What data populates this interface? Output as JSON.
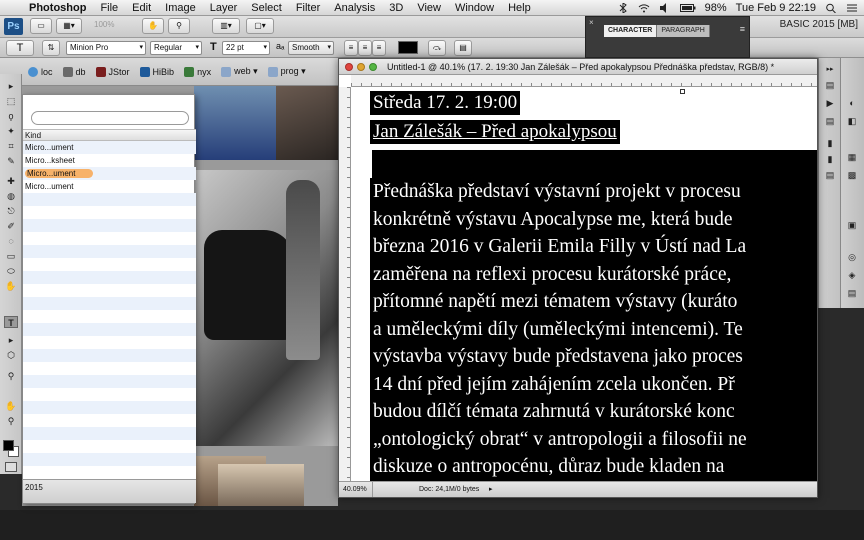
{
  "menubar": {
    "apple": "",
    "items": [
      "Photoshop",
      "File",
      "Edit",
      "Image",
      "Layer",
      "Select",
      "Filter",
      "Analysis",
      "3D",
      "View",
      "Window",
      "Help"
    ],
    "battery": "98%",
    "datetime": "Tue Feb 9  22:19"
  },
  "appbar": {
    "logo": "Ps",
    "zoom": "100%",
    "workspace": "BASIC 2015 [MB]"
  },
  "options": {
    "tool_glyph": "T",
    "orient_glyph": "⇅",
    "font_family": "Minion Pro",
    "font_style": "Regular",
    "font_size": "22 pt",
    "antialias": "Smooth",
    "size_glyph": "T",
    "align_left": "≡",
    "align_center": "≡",
    "align_right": "≡",
    "warp_glyph": "⤼",
    "panels_glyph": "▤",
    "cancel_glyph": "⊘",
    "commit_glyph": "✓"
  },
  "char_panel": {
    "tabs": [
      "CHARACTER",
      "PARAGRAPH"
    ],
    "close_glyph": "×",
    "menu_glyph": "≡"
  },
  "bookmarks": [
    {
      "label": "loc",
      "icon": "#4a90d0"
    },
    {
      "label": "db",
      "icon": "#6a6a6a"
    },
    {
      "label": "JStor",
      "icon": "#7a1e1e"
    },
    {
      "label": "HiBib",
      "icon": "#1e5a9a"
    },
    {
      "label": "nyx",
      "icon": "#3a7a3a"
    },
    {
      "label": "web ▾",
      "icon": "#8ba6c9"
    },
    {
      "label": "prog ▾",
      "icon": "#8ba6c9"
    }
  ],
  "finder": {
    "column_kind": "Kind",
    "rows": [
      "Micro...ument",
      "Micro...ksheet",
      "Micro...ument",
      "Micro...ument"
    ],
    "selected_index": 2,
    "footer": "2015"
  },
  "document": {
    "title": "Untitled-1 @ 40.1% (17. 2. 19:30 Jan Zálešák – Před apokalypsou  Přednáška představ, RGB/8) *",
    "zoom": "40.09%",
    "doc_size": "Doc: 24,1M/0 bytes",
    "heading_lines": [
      "Středa 17. 2. 19:00",
      "Jan Zálešák – Před apokalypsou"
    ],
    "body_lines": [
      "Přednáška představí výstavní projekt v procesu",
      "konkrétně výstavu Apocalypse me, která bude",
      "března 2016 v Galerii Emila Filly v Ústí nad La",
      "zaměřena na reflexi procesu kurátorské práce,",
      "přítomné napětí mezi tématem výstavy (kuráto",
      "a uměleckými díly (uměleckými intencemi). Te",
      "výstavba výstavy bude představena jako proces",
      "14 dní před jejím zahájením zcela ukončen. Př",
      "budou dílčí témata zahrnutá v kurátorské konc",
      "„ontologický obrat“ v antropologii a filosofii ne",
      "diskuze o antropocénu, důraz bude kladen na"
    ]
  },
  "tools": [
    "▸",
    "⬚",
    "ϙ",
    "✦",
    "⌗",
    "✎",
    "✚",
    "◍",
    "⎋",
    "✐",
    "◌",
    "▭",
    "⬭",
    "✋",
    "T",
    "▸",
    "⬡",
    "⚲",
    "✋",
    "⚲"
  ],
  "right_icons_1": [
    "▸▸",
    "▤",
    "▶",
    "▤",
    "▮",
    "▮",
    "▤"
  ],
  "right_icons_2": [
    "◐",
    "◧",
    "▦",
    "▩",
    "▣",
    "◎",
    "◈",
    "▤"
  ],
  "colors": {
    "accent_selection": "#f7b26a",
    "ps_blue": "#1d4f86"
  }
}
